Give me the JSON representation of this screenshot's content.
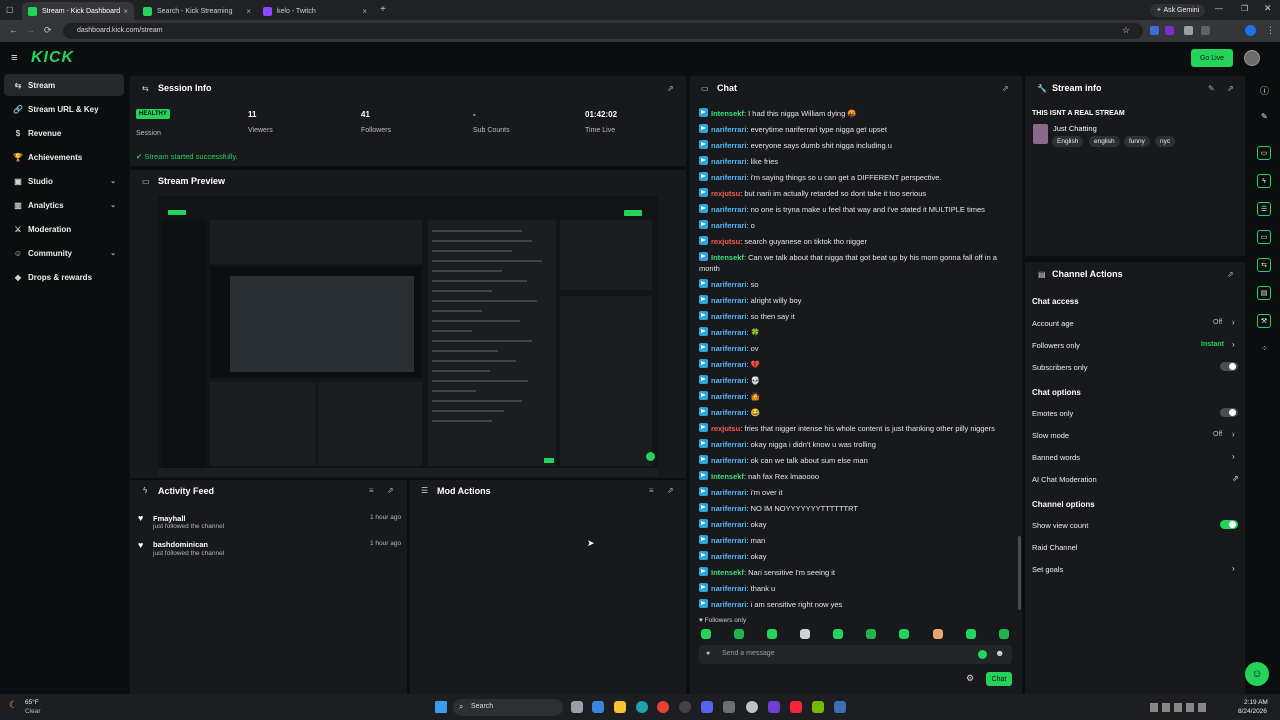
{
  "browser": {
    "tabs": [
      {
        "title": "Stream - Kick Dashboard"
      },
      {
        "title": "Search - Kick Streaming"
      },
      {
        "title": "kelo - Twitch"
      }
    ],
    "new_tab": "+",
    "url": "dashboard.kick.com/stream",
    "gemini": "Ask Gemini"
  },
  "header": {
    "logo": "KICK",
    "golive": "Go Live"
  },
  "sidebar": {
    "items": [
      {
        "label": "Stream",
        "icon": "⇆",
        "chev": ""
      },
      {
        "label": "Stream URL & Key",
        "icon": "🔗",
        "chev": ""
      },
      {
        "label": "Revenue",
        "icon": "$",
        "chev": ""
      },
      {
        "label": "Achievements",
        "icon": "🏆",
        "chev": ""
      },
      {
        "label": "Studio",
        "icon": "▣",
        "chev": "⌄"
      },
      {
        "label": "Analytics",
        "icon": "▥",
        "chev": "⌄"
      },
      {
        "label": "Moderation",
        "icon": "⚔",
        "chev": ""
      },
      {
        "label": "Community",
        "icon": "☺",
        "chev": "⌄"
      },
      {
        "label": "Drops & rewards",
        "icon": "◆",
        "chev": ""
      }
    ]
  },
  "session": {
    "title": "Session Info",
    "status_badge": "HEALTHY",
    "session_label": "Session",
    "viewers_value": "11",
    "viewers_label": "Viewers",
    "followers_value": "41",
    "followers_label": "Followers",
    "subs_value": "-",
    "subs_label": "Sub Counts",
    "time_value": "01:42:02",
    "time_label": "Time Live",
    "success": "Stream started successfully."
  },
  "preview": {
    "title": "Stream Preview"
  },
  "activity": {
    "title": "Activity Feed",
    "items": [
      {
        "name": "Fmayhall",
        "sub": "just followed the channel",
        "time": "1 hour ago"
      },
      {
        "name": "bashdominican",
        "sub": "just followed the channel",
        "time": "1 hour ago"
      }
    ]
  },
  "mod_actions": {
    "title": "Mod Actions"
  },
  "chat": {
    "title": "Chat",
    "messages": [
      {
        "user": "Intensekf",
        "color": "#2fe37a",
        "text": "I had this nigga William dying 🤬"
      },
      {
        "user": "nariferrari",
        "color": "#4fb8ff",
        "text": "everytime nariferrari type nigga get upset"
      },
      {
        "user": "nariferrari",
        "color": "#4fb8ff",
        "text": "everyone says dumb shit nigga including u"
      },
      {
        "user": "nariferrari",
        "color": "#4fb8ff",
        "text": "like fries"
      },
      {
        "user": "nariferrari",
        "color": "#4fb8ff",
        "text": "i'm saying things so u can get a DIFFERENT perspective."
      },
      {
        "user": "rexjutsu",
        "color": "#ff5a4f",
        "text": "but narii im actually retarded so dont take it too serious"
      },
      {
        "user": "nariferrari",
        "color": "#4fb8ff",
        "text": "no one is tryna make u feel that way and i've stated it MULTIPLE times"
      },
      {
        "user": "nariferrari",
        "color": "#4fb8ff",
        "text": "o"
      },
      {
        "user": "rexjutsu",
        "color": "#ff5a4f",
        "text": "search guyanese on tiktok tho nigger"
      },
      {
        "user": "Intensekf",
        "color": "#2fe37a",
        "text": "Can we talk about that nigga that got beat up by his mom gonna fall off in a month"
      },
      {
        "user": "nariferrari",
        "color": "#4fb8ff",
        "text": "so"
      },
      {
        "user": "nariferrari",
        "color": "#4fb8ff",
        "text": "alright willy boy"
      },
      {
        "user": "nariferrari",
        "color": "#4fb8ff",
        "text": "so then say it"
      },
      {
        "user": "nariferrari",
        "color": "#4fb8ff",
        "text": "🍀"
      },
      {
        "user": "nariferrari",
        "color": "#4fb8ff",
        "text": "ov"
      },
      {
        "user": "nariferrari",
        "color": "#4fb8ff",
        "text": "💔"
      },
      {
        "user": "nariferrari",
        "color": "#4fb8ff",
        "text": "💀"
      },
      {
        "user": "nariferrari",
        "color": "#4fb8ff",
        "text": "🤷"
      },
      {
        "user": "nariferrari",
        "color": "#4fb8ff",
        "text": "😂"
      },
      {
        "user": "rexjutsu",
        "color": "#ff5a4f",
        "text": "fries that nigger intense his whole content is just thanking other pilly niggers"
      },
      {
        "user": "nariferrari",
        "color": "#4fb8ff",
        "text": "okay nigga i didn't know u was trolling"
      },
      {
        "user": "nariferrari",
        "color": "#4fb8ff",
        "text": "ok can we talk about sum else man"
      },
      {
        "user": "Intensekf",
        "color": "#2fe37a",
        "text": "nah fax Rex lmaoooo"
      },
      {
        "user": "nariferrari",
        "color": "#4fb8ff",
        "text": "i'm over it"
      },
      {
        "user": "nariferrari",
        "color": "#4fb8ff",
        "text": "NO IM NOYYYYYYYTTTTTTRT"
      },
      {
        "user": "nariferrari",
        "color": "#4fb8ff",
        "text": "okay"
      },
      {
        "user": "nariferrari",
        "color": "#4fb8ff",
        "text": "man"
      },
      {
        "user": "nariferrari",
        "color": "#4fb8ff",
        "text": "okay"
      },
      {
        "user": "Intensekf",
        "color": "#2fe37a",
        "text": "Nari sensitive I'm seeing it"
      },
      {
        "user": "nariferrari",
        "color": "#4fb8ff",
        "text": "thank u"
      },
      {
        "user": "nariferrari",
        "color": "#4fb8ff",
        "text": "i am sensitive right now yes"
      }
    ],
    "followers_only": "Followers only",
    "placeholder": "Send a message",
    "send": "Chat"
  },
  "stream_info": {
    "title": "Stream info",
    "stream_title": "THIS ISNT A REAL STREAM",
    "category": "Just Chatting",
    "tags": [
      "English",
      "english",
      "funny",
      "nyc"
    ]
  },
  "channel_actions": {
    "title": "Channel Actions",
    "chat_access": "Chat access",
    "account_age": "Account age",
    "account_age_val": "Off",
    "followers_only": "Followers only",
    "followers_only_val": "Instant",
    "subscribers_only": "Subscribers only",
    "chat_options": "Chat options",
    "emotes_only": "Emotes only",
    "slow_mode": "Slow mode",
    "slow_mode_val": "Off",
    "banned_words": "Banned words",
    "ai_moderation": "AI Chat Moderation",
    "channel_options": "Channel options",
    "show_view_count": "Show view count",
    "raid_channel": "Raid Channel",
    "set_goals": "Set goals"
  },
  "taskbar": {
    "weather_temp": "65°F",
    "weather_desc": "Clear",
    "search": "Search",
    "time": "2:19 AM",
    "date": "8/24/2026"
  },
  "colors": {
    "accent": "#24d35a",
    "panel": "#17191c",
    "bg": "#0b0e0f"
  }
}
